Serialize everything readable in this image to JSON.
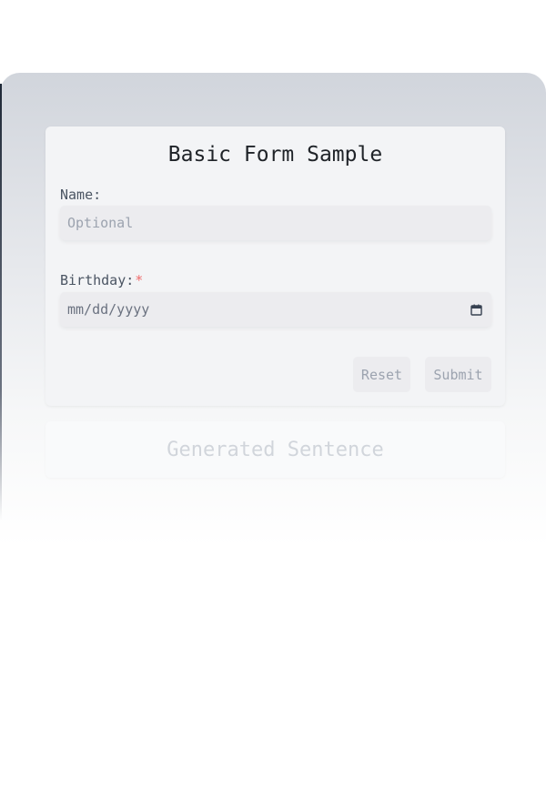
{
  "form": {
    "title": "Basic Form Sample",
    "name_label": "Name:",
    "name_placeholder": "Optional",
    "birthday_label": "Birthday:",
    "birthday_required_mark": "*",
    "birthday_value": "mm/dd/yyyy",
    "calendar_icon": "calendar-icon",
    "reset_label": "Reset",
    "submit_label": "Submit"
  },
  "output": {
    "text": "Generated Sentence"
  },
  "colors": {
    "required": "#ef6b6b",
    "card_bg": "#f3f4f6",
    "field_bg": "#ececef"
  }
}
